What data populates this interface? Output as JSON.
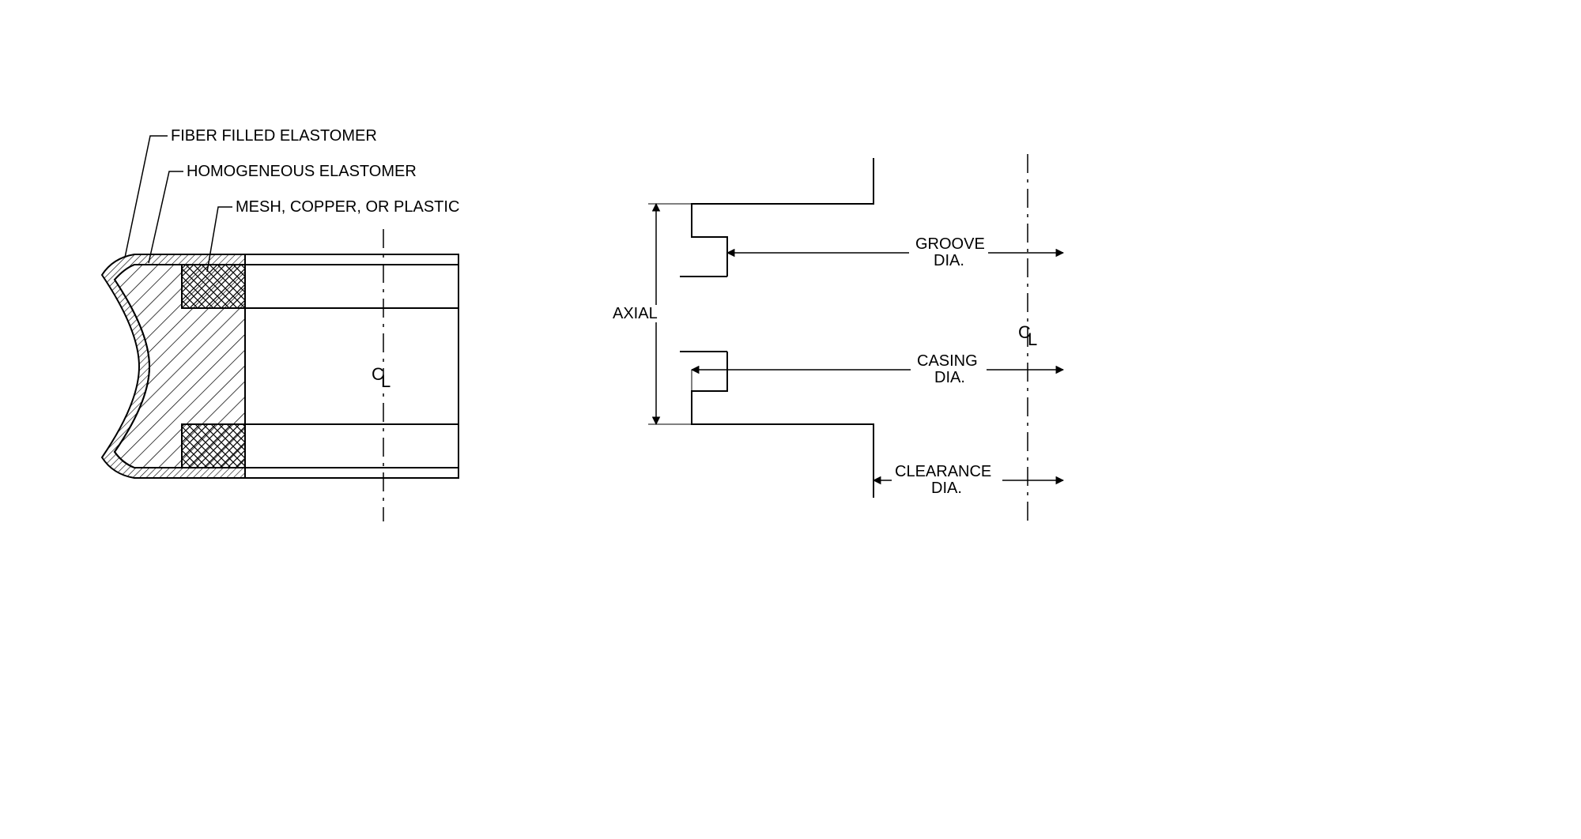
{
  "left": {
    "callouts": {
      "fiber": "FIBER FILLED ELASTOMER",
      "homogeneous": "HOMOGENEOUS ELASTOMER",
      "mesh": "MESH, COPPER, OR PLASTIC"
    },
    "cl_symbol": {
      "c": "C",
      "l": "L"
    }
  },
  "right": {
    "labels": {
      "axial": "AXIAL",
      "groove1": "GROOVE",
      "groove2": "DIA.",
      "casing1": "CASING",
      "casing2": "DIA.",
      "clearance1": "CLEARANCE",
      "clearance2": "DIA."
    },
    "cl_symbol": {
      "c": "C",
      "l": "L"
    }
  }
}
